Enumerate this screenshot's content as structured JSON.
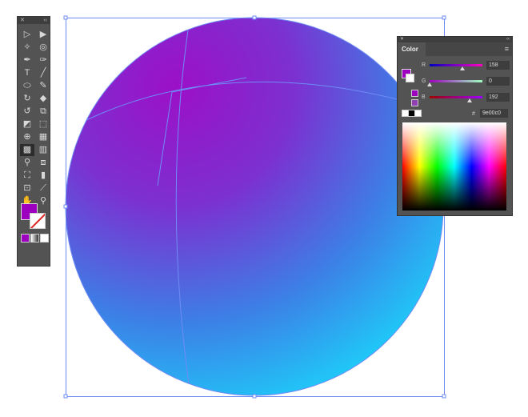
{
  "toolbar": {
    "collapse": "✕",
    "expand": "‹‹",
    "tools": [
      {
        "name": "selection-tool",
        "glyph": "▷"
      },
      {
        "name": "direct-selection-tool",
        "glyph": "▶"
      },
      {
        "name": "magic-wand-tool",
        "glyph": "✧"
      },
      {
        "name": "lasso-tool",
        "glyph": "◎"
      },
      {
        "name": "pen-tool",
        "glyph": "✒"
      },
      {
        "name": "curvature-tool",
        "glyph": "✑"
      },
      {
        "name": "type-tool",
        "glyph": "T"
      },
      {
        "name": "line-tool",
        "glyph": "╱"
      },
      {
        "name": "ellipse-tool",
        "glyph": "⬭"
      },
      {
        "name": "paintbrush-tool",
        "glyph": "✎"
      },
      {
        "name": "shaper-tool",
        "glyph": "↻"
      },
      {
        "name": "eraser-tool",
        "glyph": "◆"
      },
      {
        "name": "rotate-tool",
        "glyph": "↺"
      },
      {
        "name": "scale-tool",
        "glyph": "⧉"
      },
      {
        "name": "width-tool",
        "glyph": "◩"
      },
      {
        "name": "free-transform-tool",
        "glyph": "⬚"
      },
      {
        "name": "shape-builder-tool",
        "glyph": "⊕"
      },
      {
        "name": "perspective-grid-tool",
        "glyph": "▦"
      },
      {
        "name": "mesh-tool",
        "glyph": "▩",
        "selected": true
      },
      {
        "name": "gradient-tool",
        "glyph": "▥"
      },
      {
        "name": "eyedropper-tool",
        "glyph": "⚲"
      },
      {
        "name": "blend-tool",
        "glyph": "⧈"
      },
      {
        "name": "symbol-sprayer-tool",
        "glyph": "⛶"
      },
      {
        "name": "column-graph-tool",
        "glyph": "▮"
      },
      {
        "name": "artboard-tool",
        "glyph": "⊡"
      },
      {
        "name": "slice-tool",
        "glyph": "⟋"
      },
      {
        "name": "hand-tool",
        "glyph": "✋"
      },
      {
        "name": "zoom-tool",
        "glyph": "⚲"
      }
    ]
  },
  "color_panel": {
    "title": "Color",
    "collapse": "✕",
    "expand": "‹‹",
    "menu": "≡",
    "channels": [
      {
        "label": "R",
        "value": "158",
        "fraction": 0.62
      },
      {
        "label": "G",
        "value": "0",
        "fraction": 0.0
      },
      {
        "label": "B",
        "value": "192",
        "fraction": 0.75
      }
    ],
    "hex_label": "#",
    "hex_value": "9e00c0"
  },
  "colors": {
    "fill": "#9e00c0",
    "center": "#9c10c8",
    "edge": "#1ecbf9",
    "selection": "#5b7cf0"
  }
}
